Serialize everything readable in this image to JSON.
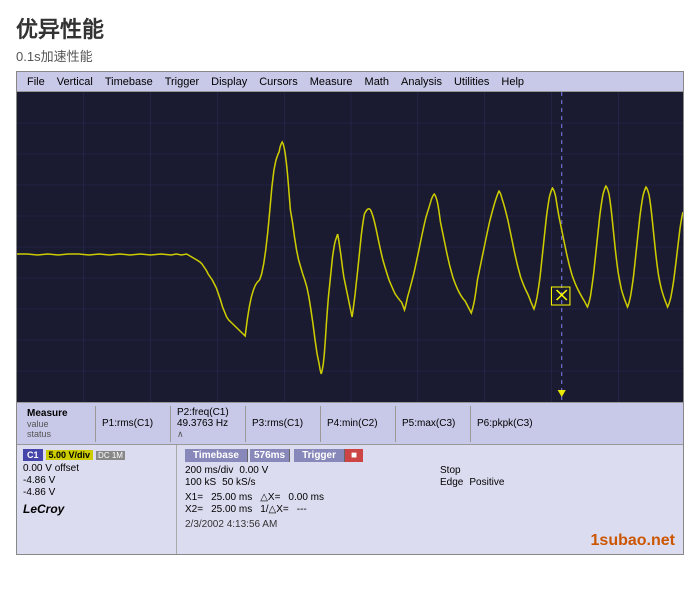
{
  "title": "优异性能",
  "subtitle": "0.1s加速性能",
  "menu": {
    "items": [
      "File",
      "Vertical",
      "Timebase",
      "Trigger",
      "Display",
      "Cursors",
      "Measure",
      "Math",
      "Analysis",
      "Utilities",
      "Help"
    ]
  },
  "measurements": {
    "col1": {
      "label": "Measure",
      "sub1": "value",
      "sub2": "status"
    },
    "col2": {
      "label": "P1:rms(C1)",
      "value": ""
    },
    "col3": {
      "label": "P2:freq(C1)",
      "value": "49.3763 Hz",
      "sub": "∧"
    },
    "col4": {
      "label": "P3:rms(C1)",
      "value": ""
    },
    "col5": {
      "label": "P4:min(C2)",
      "value": ""
    },
    "col6": {
      "label": "P5:max(C3)",
      "value": ""
    },
    "col7": {
      "label": "P6:pkpk(C3)",
      "value": ""
    }
  },
  "channel": {
    "badge": "C1",
    "badge2": "5.00 V/div",
    "badge3": "DC 1M",
    "offset": "0.00 V offset",
    "v1": "-4.86 V",
    "v2": "-4.86 V",
    "brand": "LeCroy"
  },
  "timebase_panel": {
    "title": "Timebase",
    "value": "576ms",
    "trigger_title": "Trigger",
    "trigger_value": "▣",
    "rows": [
      {
        "key": "200 ms/div",
        "key2": "0.00 V"
      },
      {
        "key": "100 kS",
        "key2": "Stop",
        "key3": "50 kS/s",
        "key4": "Positive"
      },
      {
        "key": "Edge"
      }
    ],
    "x1_label": "X1=",
    "x1_val": "25.00 ms",
    "dx_label": "△X=",
    "dx_val": "0.00 ms",
    "x2_label": "X2=",
    "x2_val": "25.00 ms",
    "dx2_label": "1/△X=",
    "dx2_val": "---"
  },
  "datetime": "2/3/2002 4:13:56 AM",
  "watermark": "1subao.net"
}
